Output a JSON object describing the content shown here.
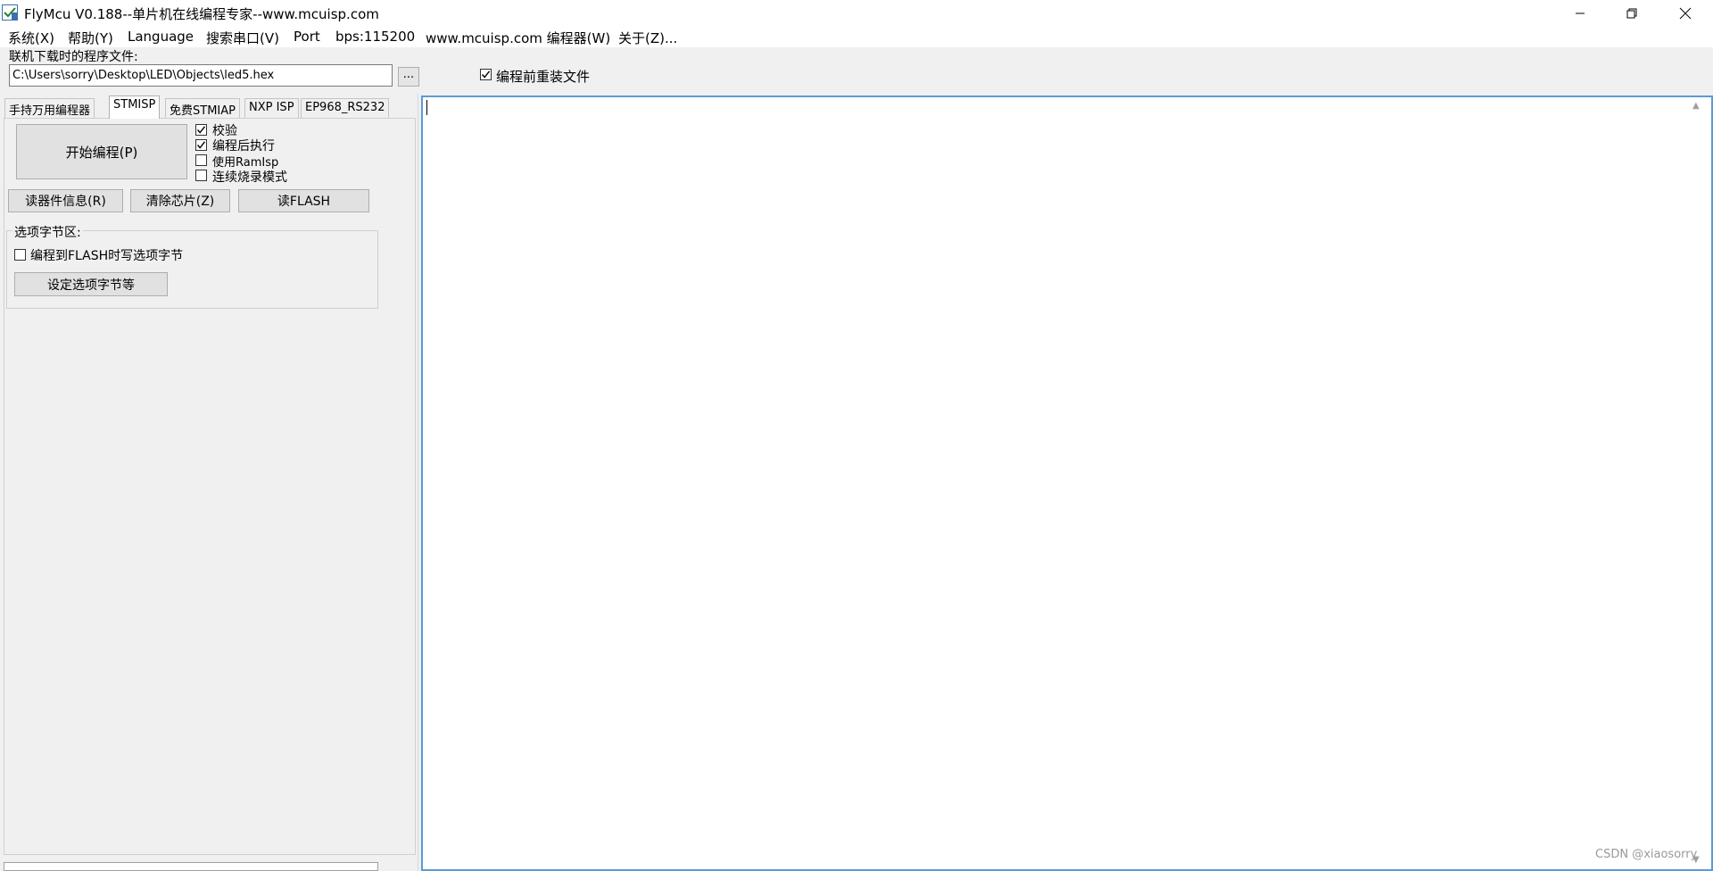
{
  "window": {
    "title": "FlyMcu V0.188--单片机在线编程专家--www.mcuisp.com",
    "app_icon": "flymcu-icon",
    "min_icon": "minimize-icon",
    "max_icon": "restore-icon",
    "close_icon": "close-icon"
  },
  "menu": {
    "items": [
      "系统(X)",
      "帮助(Y)",
      "Language",
      "搜索串口(V)",
      "Port",
      "bps:115200",
      "www.mcuisp.com 编程器(W)",
      "关于(Z)..."
    ]
  },
  "file": {
    "label": "联机下载时的程序文件:",
    "path": "C:\\Users\\sorry\\Desktop\\LED\\Objects\\led5.hex",
    "browse_label": "...",
    "reload_label": "编程前重装文件",
    "reload_checked": true
  },
  "tabs": [
    {
      "label": "手持万用编程器",
      "active": false
    },
    {
      "label": "STMISP",
      "active": true
    },
    {
      "label": "免费STMIAP",
      "active": false
    },
    {
      "label": "NXP ISP",
      "active": false
    },
    {
      "label": "EP968_RS232",
      "active": false
    }
  ],
  "stmisp": {
    "start_button": "开始编程(P)",
    "options": {
      "verify": {
        "label": "校验",
        "checked": true
      },
      "run_after": {
        "label": "编程后执行",
        "checked": true
      },
      "ram_isp": {
        "label": "使用RamIsp",
        "checked": false
      },
      "continuous": {
        "label": "连续烧录模式",
        "checked": false
      }
    },
    "read_info_button": "读器件信息(R)",
    "erase_button": "清除芯片(Z)",
    "read_flash_button": "读FLASH",
    "option_group": {
      "title": "选项字节区:",
      "write_option_label": "编程到FLASH时写选项字节",
      "write_option_checked": false,
      "set_button": "设定选项字节等"
    }
  },
  "log": {
    "content": ""
  },
  "watermark": "CSDN @xiaosorry"
}
